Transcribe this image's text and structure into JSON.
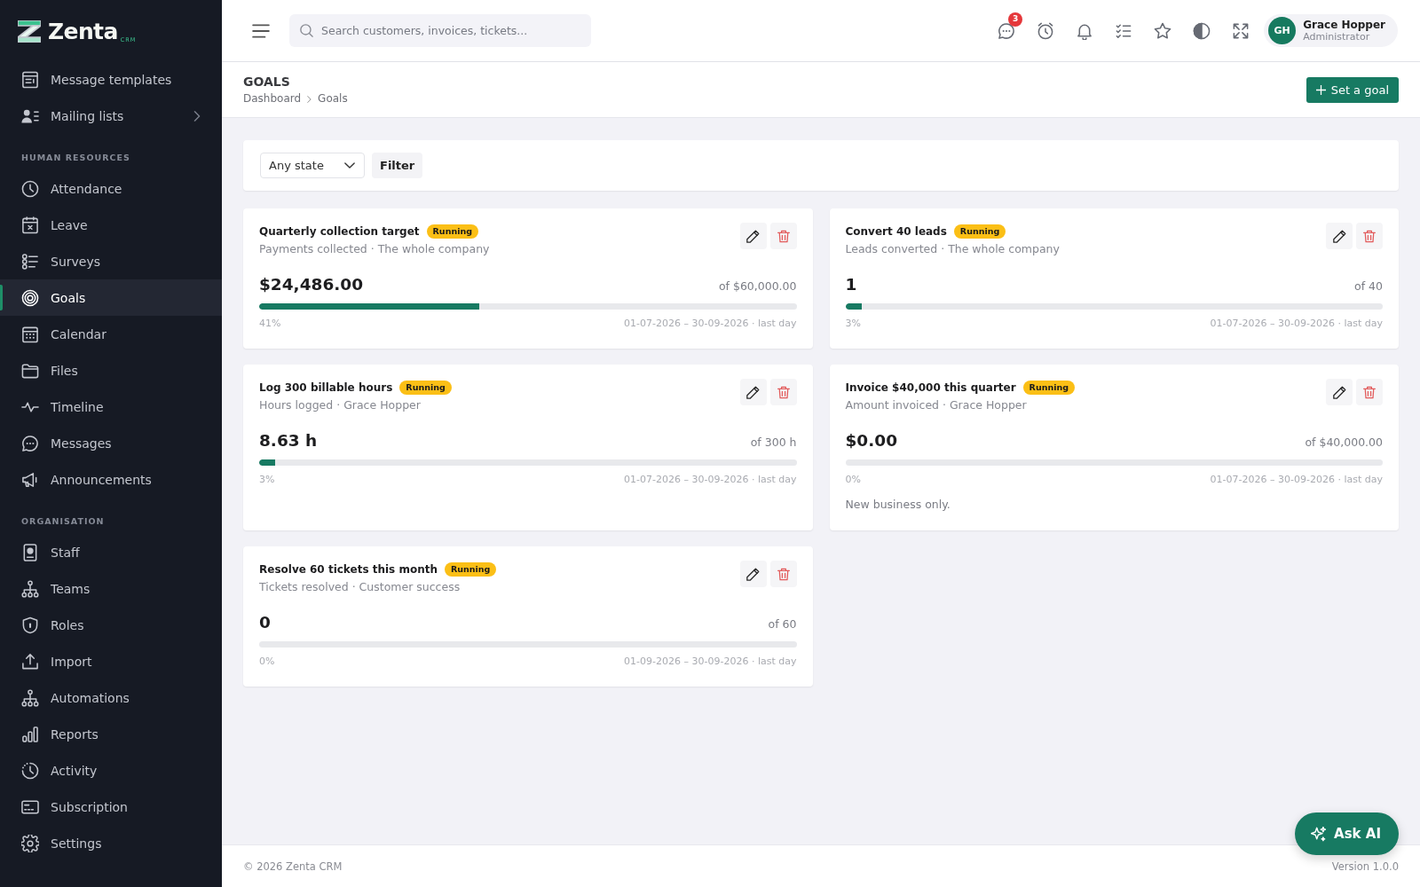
{
  "sidebar": {
    "logo": {
      "name": "Zenta",
      "suffix": "CRM"
    },
    "sections": [
      {
        "items": [
          {
            "label": "Message templates",
            "selected": false,
            "submenu": false
          },
          {
            "label": "Mailing lists",
            "selected": false,
            "submenu": true
          }
        ]
      },
      {
        "heading": "HUMAN RESOURCES",
        "items": [
          {
            "label": "Attendance",
            "selected": false,
            "submenu": false
          },
          {
            "label": "Leave",
            "selected": false,
            "submenu": false
          },
          {
            "label": "Surveys",
            "selected": false,
            "submenu": false
          },
          {
            "label": "Goals",
            "selected": true,
            "submenu": false
          },
          {
            "label": "Calendar",
            "selected": false,
            "submenu": false
          },
          {
            "label": "Files",
            "selected": false,
            "submenu": false
          },
          {
            "label": "Timeline",
            "selected": false,
            "submenu": false
          },
          {
            "label": "Messages",
            "selected": false,
            "submenu": false
          },
          {
            "label": "Announcements",
            "selected": false,
            "submenu": false
          }
        ]
      },
      {
        "heading": "ORGANISATION",
        "items": [
          {
            "label": "Staff",
            "selected": false,
            "submenu": false
          },
          {
            "label": "Teams",
            "selected": false,
            "submenu": false
          },
          {
            "label": "Roles",
            "selected": false,
            "submenu": false
          },
          {
            "label": "Import",
            "selected": false,
            "submenu": false
          },
          {
            "label": "Automations",
            "selected": false,
            "submenu": false
          },
          {
            "label": "Reports",
            "selected": false,
            "submenu": false
          },
          {
            "label": "Activity",
            "selected": false,
            "submenu": false
          },
          {
            "label": "Subscription",
            "selected": false,
            "submenu": false
          },
          {
            "label": "Settings",
            "selected": false,
            "submenu": false
          }
        ]
      }
    ]
  },
  "header": {
    "search": {
      "placeholder": "Search customers, invoices, tickets..."
    },
    "messages_badge": "3",
    "user": {
      "initials": "GH",
      "name": "Grace Hopper",
      "role": "Administrator"
    }
  },
  "page": {
    "title": "GOALS",
    "breadcrumb": [
      {
        "label": "Dashboard"
      },
      {
        "label": "Goals"
      }
    ],
    "action": "Set a goal"
  },
  "filters": {
    "state": {
      "value": "Any state"
    },
    "button": "Filter"
  },
  "goals": [
    {
      "title": "Quarterly collection target",
      "status": "Running",
      "subtitle": "Payments collected · The whole company",
      "value": "$24,486.00",
      "target": "of $60,000.00",
      "level": 0.41,
      "percent": "41%",
      "period": "01-07-2026 – 30-09-2026 · last day"
    },
    {
      "title": "Convert 40 leads",
      "status": "Running",
      "subtitle": "Leads converted · The whole company",
      "value": "1",
      "target": "of 40",
      "level": 0.03,
      "percent": "3%",
      "period": "01-07-2026 – 30-09-2026 · last day"
    },
    {
      "title": "Log 300 billable hours",
      "status": "Running",
      "subtitle": "Hours logged · Grace Hopper",
      "value": "8.63 h",
      "target": "of 300 h",
      "level": 0.03,
      "percent": "3%",
      "period": "01-07-2026 – 30-09-2026 · last day"
    },
    {
      "title": "Invoice $40,000 this quarter",
      "status": "Running",
      "subtitle": "Amount invoiced · Grace Hopper",
      "value": "$0.00",
      "target": "of $40,000.00",
      "level": 0,
      "percent": "0%",
      "period": "01-07-2026 – 30-09-2026 · last day",
      "note": "New business only."
    },
    {
      "title": "Resolve 60 tickets this month",
      "status": "Running",
      "subtitle": "Tickets resolved · Customer success",
      "value": "0",
      "target": "of 60",
      "level": 0,
      "percent": "0%",
      "period": "01-09-2026 – 30-09-2026 · last day"
    }
  ],
  "footer": {
    "copyright": "© 2026 Zenta CRM",
    "version": "Version 1.0.0"
  },
  "assistant": {
    "label": "Ask AI"
  }
}
